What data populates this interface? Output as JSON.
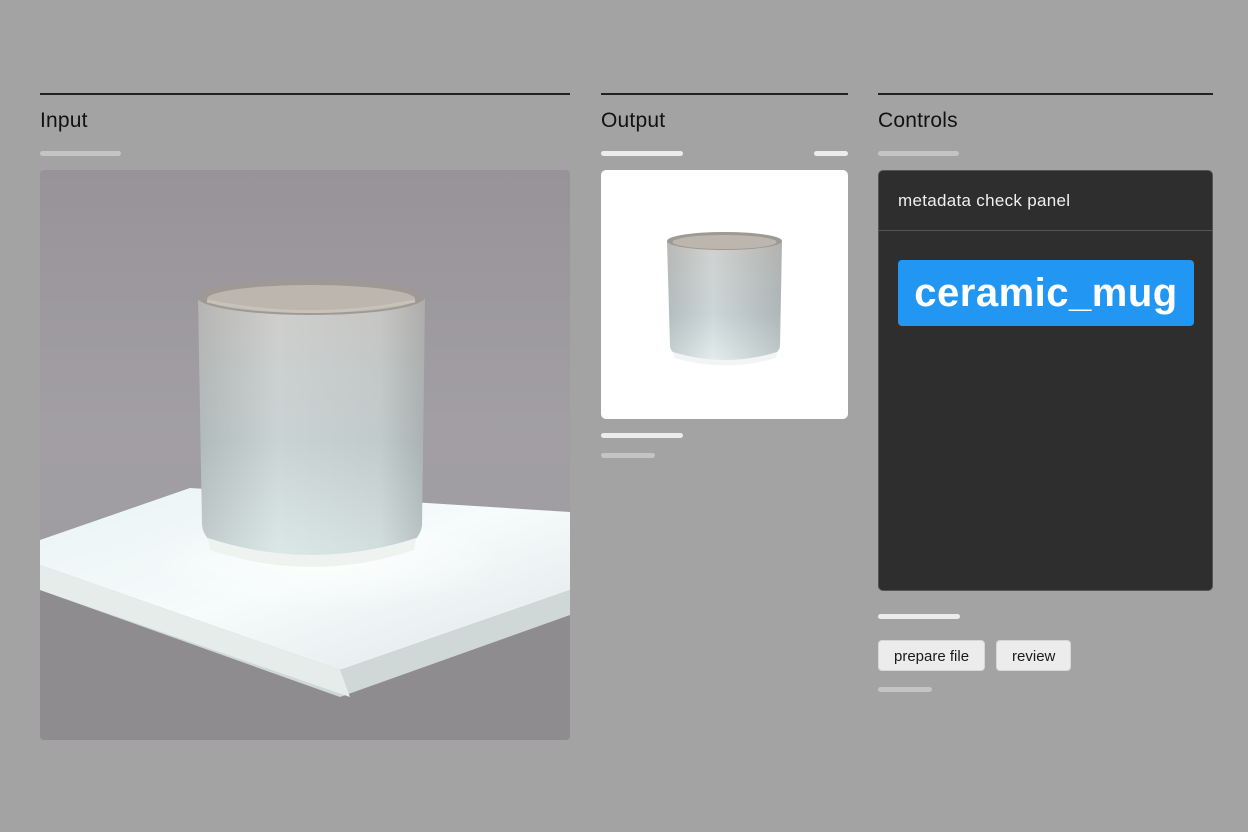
{
  "columns": {
    "input": {
      "title": "Input"
    },
    "output": {
      "title": "Output"
    },
    "controls": {
      "title": "Controls"
    }
  },
  "panel": {
    "header": "metadata check panel",
    "tag_label": "ceramic_mug"
  },
  "buttons": {
    "prepare": "prepare file",
    "review": "review"
  },
  "colors": {
    "background": "#a3a3a3",
    "panel_bg": "#2e2e2e",
    "tag_bg": "#2196f3",
    "button_bg": "#ececec"
  },
  "icons": {
    "input_image": "ceramic-cup-on-lightbox-photo",
    "output_image": "ceramic-cup-cutout-thumbnail"
  }
}
